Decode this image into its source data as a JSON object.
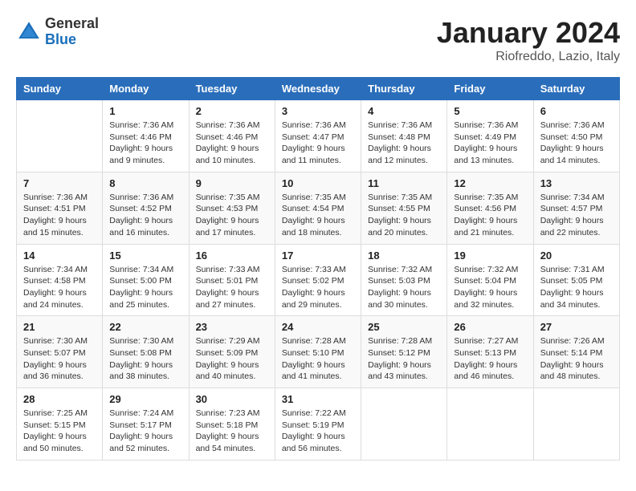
{
  "logo": {
    "general": "General",
    "blue": "Blue"
  },
  "title": "January 2024",
  "subtitle": "Riofreddo, Lazio, Italy",
  "days_header": [
    "Sunday",
    "Monday",
    "Tuesday",
    "Wednesday",
    "Thursday",
    "Friday",
    "Saturday"
  ],
  "weeks": [
    [
      {
        "day": "",
        "info": ""
      },
      {
        "day": "1",
        "info": "Sunrise: 7:36 AM\nSunset: 4:46 PM\nDaylight: 9 hours\nand 9 minutes."
      },
      {
        "day": "2",
        "info": "Sunrise: 7:36 AM\nSunset: 4:46 PM\nDaylight: 9 hours\nand 10 minutes."
      },
      {
        "day": "3",
        "info": "Sunrise: 7:36 AM\nSunset: 4:47 PM\nDaylight: 9 hours\nand 11 minutes."
      },
      {
        "day": "4",
        "info": "Sunrise: 7:36 AM\nSunset: 4:48 PM\nDaylight: 9 hours\nand 12 minutes."
      },
      {
        "day": "5",
        "info": "Sunrise: 7:36 AM\nSunset: 4:49 PM\nDaylight: 9 hours\nand 13 minutes."
      },
      {
        "day": "6",
        "info": "Sunrise: 7:36 AM\nSunset: 4:50 PM\nDaylight: 9 hours\nand 14 minutes."
      }
    ],
    [
      {
        "day": "7",
        "info": "Sunrise: 7:36 AM\nSunset: 4:51 PM\nDaylight: 9 hours\nand 15 minutes."
      },
      {
        "day": "8",
        "info": "Sunrise: 7:36 AM\nSunset: 4:52 PM\nDaylight: 9 hours\nand 16 minutes."
      },
      {
        "day": "9",
        "info": "Sunrise: 7:35 AM\nSunset: 4:53 PM\nDaylight: 9 hours\nand 17 minutes."
      },
      {
        "day": "10",
        "info": "Sunrise: 7:35 AM\nSunset: 4:54 PM\nDaylight: 9 hours\nand 18 minutes."
      },
      {
        "day": "11",
        "info": "Sunrise: 7:35 AM\nSunset: 4:55 PM\nDaylight: 9 hours\nand 20 minutes."
      },
      {
        "day": "12",
        "info": "Sunrise: 7:35 AM\nSunset: 4:56 PM\nDaylight: 9 hours\nand 21 minutes."
      },
      {
        "day": "13",
        "info": "Sunrise: 7:34 AM\nSunset: 4:57 PM\nDaylight: 9 hours\nand 22 minutes."
      }
    ],
    [
      {
        "day": "14",
        "info": "Sunrise: 7:34 AM\nSunset: 4:58 PM\nDaylight: 9 hours\nand 24 minutes."
      },
      {
        "day": "15",
        "info": "Sunrise: 7:34 AM\nSunset: 5:00 PM\nDaylight: 9 hours\nand 25 minutes."
      },
      {
        "day": "16",
        "info": "Sunrise: 7:33 AM\nSunset: 5:01 PM\nDaylight: 9 hours\nand 27 minutes."
      },
      {
        "day": "17",
        "info": "Sunrise: 7:33 AM\nSunset: 5:02 PM\nDaylight: 9 hours\nand 29 minutes."
      },
      {
        "day": "18",
        "info": "Sunrise: 7:32 AM\nSunset: 5:03 PM\nDaylight: 9 hours\nand 30 minutes."
      },
      {
        "day": "19",
        "info": "Sunrise: 7:32 AM\nSunset: 5:04 PM\nDaylight: 9 hours\nand 32 minutes."
      },
      {
        "day": "20",
        "info": "Sunrise: 7:31 AM\nSunset: 5:05 PM\nDaylight: 9 hours\nand 34 minutes."
      }
    ],
    [
      {
        "day": "21",
        "info": "Sunrise: 7:30 AM\nSunset: 5:07 PM\nDaylight: 9 hours\nand 36 minutes."
      },
      {
        "day": "22",
        "info": "Sunrise: 7:30 AM\nSunset: 5:08 PM\nDaylight: 9 hours\nand 38 minutes."
      },
      {
        "day": "23",
        "info": "Sunrise: 7:29 AM\nSunset: 5:09 PM\nDaylight: 9 hours\nand 40 minutes."
      },
      {
        "day": "24",
        "info": "Sunrise: 7:28 AM\nSunset: 5:10 PM\nDaylight: 9 hours\nand 41 minutes."
      },
      {
        "day": "25",
        "info": "Sunrise: 7:28 AM\nSunset: 5:12 PM\nDaylight: 9 hours\nand 43 minutes."
      },
      {
        "day": "26",
        "info": "Sunrise: 7:27 AM\nSunset: 5:13 PM\nDaylight: 9 hours\nand 46 minutes."
      },
      {
        "day": "27",
        "info": "Sunrise: 7:26 AM\nSunset: 5:14 PM\nDaylight: 9 hours\nand 48 minutes."
      }
    ],
    [
      {
        "day": "28",
        "info": "Sunrise: 7:25 AM\nSunset: 5:15 PM\nDaylight: 9 hours\nand 50 minutes."
      },
      {
        "day": "29",
        "info": "Sunrise: 7:24 AM\nSunset: 5:17 PM\nDaylight: 9 hours\nand 52 minutes."
      },
      {
        "day": "30",
        "info": "Sunrise: 7:23 AM\nSunset: 5:18 PM\nDaylight: 9 hours\nand 54 minutes."
      },
      {
        "day": "31",
        "info": "Sunrise: 7:22 AM\nSunset: 5:19 PM\nDaylight: 9 hours\nand 56 minutes."
      },
      {
        "day": "",
        "info": ""
      },
      {
        "day": "",
        "info": ""
      },
      {
        "day": "",
        "info": ""
      }
    ]
  ]
}
